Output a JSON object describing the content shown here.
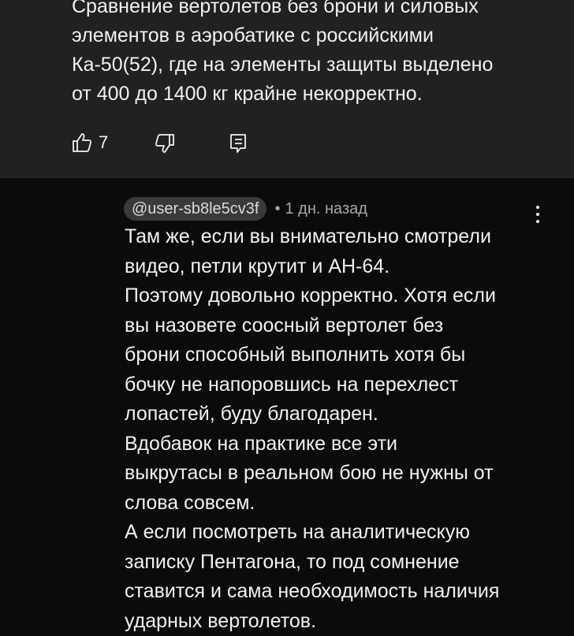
{
  "parent_comment": {
    "text": "Сравнение вертолетов без брони и силовых\nэлементов в аэробатике с российскими\nКа-50(52), где на элементы защиты выделено\nот 400 до 1400 кг крайне некорректно.",
    "likes": "7"
  },
  "reply": {
    "handle": "@user-sb8le5cv3f",
    "time": "1 дн. назад",
    "paragraphs": [
      "Там же, если вы внимательно смотрели\nвидео, петли крутит и АН-64.",
      "Поэтому довольно корректно. Хотя если\nвы назовете соосный вертолет без\nброни способный выполнить хотя бы\nбочку не напоровшись на перехлест\nлопастей, буду благодарен.",
      "Вдобавок на практике все эти\nвыкрутасы в реальном бою не нужны от\nслова совсем.",
      "А если посмотреть на аналитическую\nзаписку Пентагона, то под сомнение\nставится и сама необходимость наличия\nударных вертолетов."
    ]
  },
  "icons": {
    "like": "thumbs-up-icon",
    "dislike": "thumbs-down-icon",
    "reply": "reply-comment-icon",
    "more": "more-vertical-icon"
  }
}
